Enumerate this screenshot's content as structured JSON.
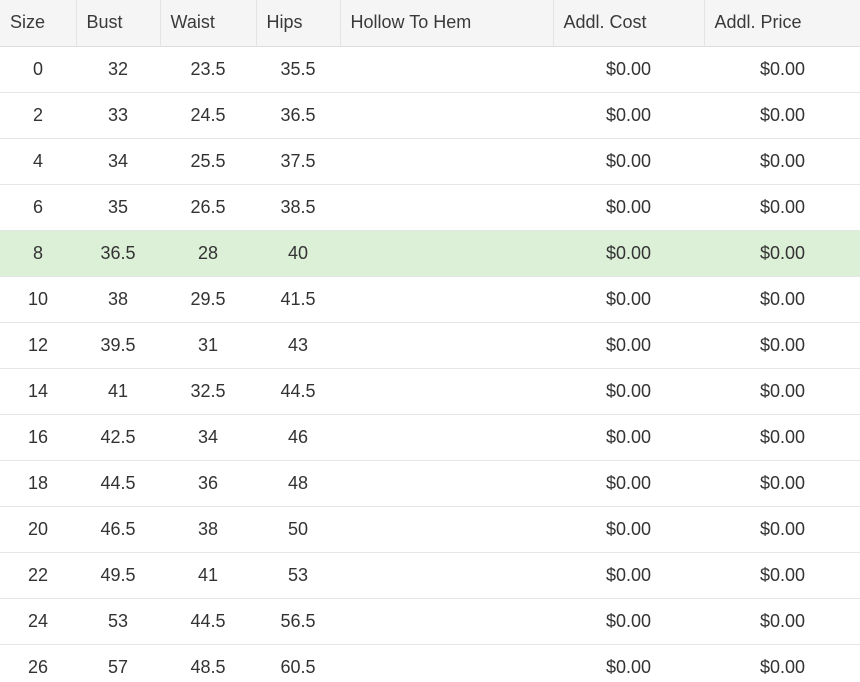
{
  "table": {
    "headers": {
      "size": "Size",
      "bust": "Bust",
      "waist": "Waist",
      "hips": "Hips",
      "hollow_to_hem": "Hollow To Hem",
      "addl_cost": "Addl. Cost",
      "addl_price": "Addl. Price"
    },
    "highlight_color": "#dcefd7",
    "highlighted_size": "8",
    "rows": [
      {
        "size": "0",
        "bust": "32",
        "waist": "23.5",
        "hips": "35.5",
        "hollow_to_hem": "",
        "addl_cost": "$0.00",
        "addl_price": "$0.00"
      },
      {
        "size": "2",
        "bust": "33",
        "waist": "24.5",
        "hips": "36.5",
        "hollow_to_hem": "",
        "addl_cost": "$0.00",
        "addl_price": "$0.00"
      },
      {
        "size": "4",
        "bust": "34",
        "waist": "25.5",
        "hips": "37.5",
        "hollow_to_hem": "",
        "addl_cost": "$0.00",
        "addl_price": "$0.00"
      },
      {
        "size": "6",
        "bust": "35",
        "waist": "26.5",
        "hips": "38.5",
        "hollow_to_hem": "",
        "addl_cost": "$0.00",
        "addl_price": "$0.00"
      },
      {
        "size": "8",
        "bust": "36.5",
        "waist": "28",
        "hips": "40",
        "hollow_to_hem": "",
        "addl_cost": "$0.00",
        "addl_price": "$0.00"
      },
      {
        "size": "10",
        "bust": "38",
        "waist": "29.5",
        "hips": "41.5",
        "hollow_to_hem": "",
        "addl_cost": "$0.00",
        "addl_price": "$0.00"
      },
      {
        "size": "12",
        "bust": "39.5",
        "waist": "31",
        "hips": "43",
        "hollow_to_hem": "",
        "addl_cost": "$0.00",
        "addl_price": "$0.00"
      },
      {
        "size": "14",
        "bust": "41",
        "waist": "32.5",
        "hips": "44.5",
        "hollow_to_hem": "",
        "addl_cost": "$0.00",
        "addl_price": "$0.00"
      },
      {
        "size": "16",
        "bust": "42.5",
        "waist": "34",
        "hips": "46",
        "hollow_to_hem": "",
        "addl_cost": "$0.00",
        "addl_price": "$0.00"
      },
      {
        "size": "18",
        "bust": "44.5",
        "waist": "36",
        "hips": "48",
        "hollow_to_hem": "",
        "addl_cost": "$0.00",
        "addl_price": "$0.00"
      },
      {
        "size": "20",
        "bust": "46.5",
        "waist": "38",
        "hips": "50",
        "hollow_to_hem": "",
        "addl_cost": "$0.00",
        "addl_price": "$0.00"
      },
      {
        "size": "22",
        "bust": "49.5",
        "waist": "41",
        "hips": "53",
        "hollow_to_hem": "",
        "addl_cost": "$0.00",
        "addl_price": "$0.00"
      },
      {
        "size": "24",
        "bust": "53",
        "waist": "44.5",
        "hips": "56.5",
        "hollow_to_hem": "",
        "addl_cost": "$0.00",
        "addl_price": "$0.00"
      },
      {
        "size": "26",
        "bust": "57",
        "waist": "48.5",
        "hips": "60.5",
        "hollow_to_hem": "",
        "addl_cost": "$0.00",
        "addl_price": "$0.00"
      }
    ]
  }
}
